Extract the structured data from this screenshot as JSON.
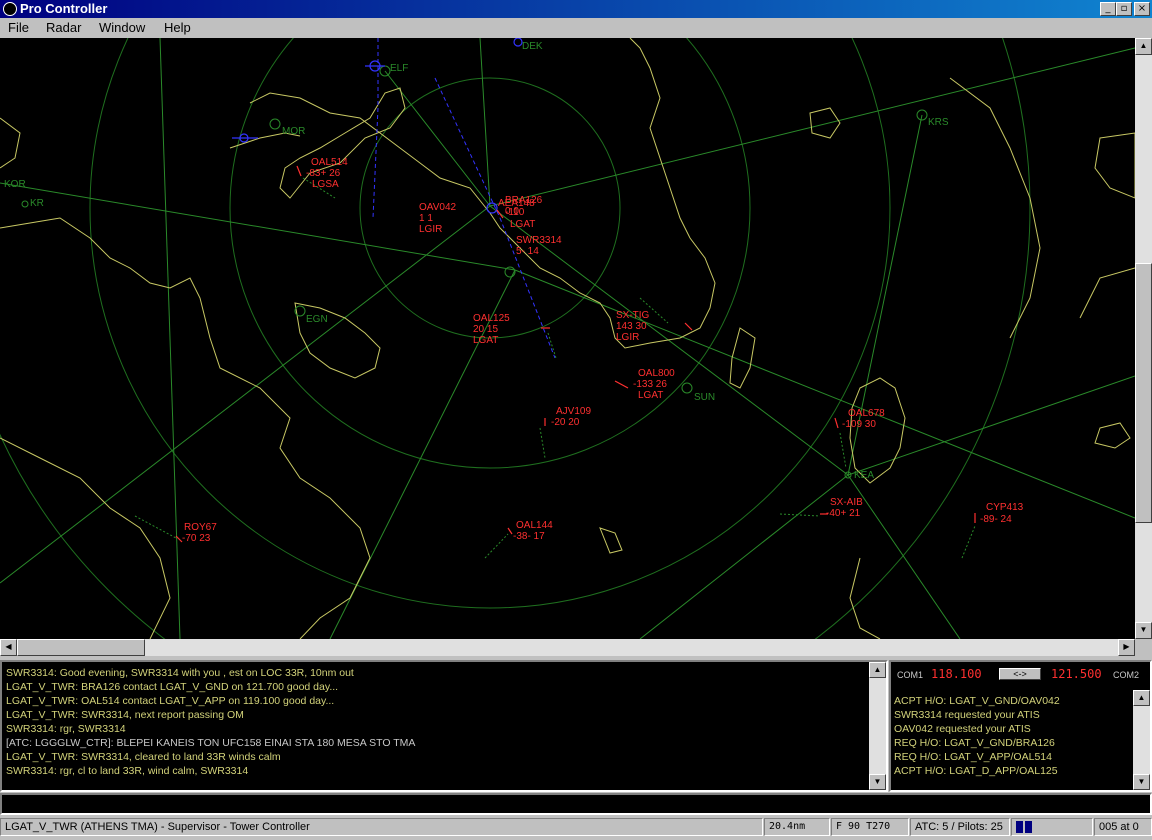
{
  "window": {
    "title": "Pro Controller",
    "minimize": "_",
    "restore": "▫",
    "close": "×"
  },
  "menu": [
    "File",
    "Radar",
    "Window",
    "Help"
  ],
  "fixes": [
    {
      "name": "ELF"
    },
    {
      "name": "DEK"
    },
    {
      "name": "MOR"
    },
    {
      "name": "KRS"
    },
    {
      "name": "KR"
    },
    {
      "name": "KOR"
    },
    {
      "name": "EGN"
    },
    {
      "name": "SUN"
    },
    {
      "name": "KEA"
    }
  ],
  "aircraft": [
    {
      "callsign": "OAL514",
      "line2": "-83+ 26",
      "dest": "LGSA"
    },
    {
      "callsign": "OAV042",
      "line2": "1  1",
      "dest": "LGIR"
    },
    {
      "callsign": "BRA126",
      "line2": "0   0",
      "dest": ""
    },
    {
      "callsign": "AEA148",
      "line2": "-110",
      "dest": "LGAT"
    },
    {
      "callsign": "SWR3314",
      "line2": "5- 14",
      "dest": ""
    },
    {
      "callsign": "OAL125",
      "line2": "20  15",
      "dest": "LGAT"
    },
    {
      "callsign": "SX-TIG",
      "line2": "143  30",
      "dest": "LGIR"
    },
    {
      "callsign": "OAL800",
      "line2": "-133  26",
      "dest": "LGAT"
    },
    {
      "callsign": "AJV109",
      "line2": "-20  20",
      "dest": ""
    },
    {
      "callsign": "OAL678",
      "line2": "-109  30",
      "dest": ""
    },
    {
      "callsign": "SX-AIB",
      "line2": "-40+ 21",
      "dest": ""
    },
    {
      "callsign": "CYP413",
      "line2": "-89- 24",
      "dest": ""
    },
    {
      "callsign": "ROY67",
      "line2": "-70  23",
      "dest": ""
    },
    {
      "callsign": "OAL144",
      "line2": "-38- 17",
      "dest": ""
    }
  ],
  "messages": [
    "SWR3314: Good evening, SWR3314 with you , est on LOC 33R, 10nm out",
    "LGAT_V_TWR: BRA126 contact LGAT_V_GND on 121.700 good day...",
    "LGAT_V_TWR: OAL514 contact LGAT_V_APP on 119.100 good day...",
    "LGAT_V_TWR: SWR3314, next report passing OM",
    "SWR3314: rgr, SWR3314",
    "[ATC: LGGGLW_CTR]: BLEPEI KANEIS TON UFC158 EINAI STA 180 MESA STO TMA",
    "LGAT_V_TWR: SWR3314, cleared to land 33R winds calm",
    "SWR3314: rgr, cl to land 33R, wind calm, SWR3314"
  ],
  "com": {
    "com1_label": "COM1",
    "com1_freq": "118.100",
    "swap_label": "<->",
    "com2_freq": "121.500",
    "com2_label": "COM2"
  },
  "notifications": [
    "ACPT H/O: LGAT_V_GND/OAV042",
    "SWR3314 requested your ATIS",
    "OAV042 requested your ATIS",
    "REQ H/O: LGAT_V_GND/BRA126",
    "REQ H/O: LGAT_V_APP/OAL514",
    "ACPT H/O: LGAT_D_APP/OAL125"
  ],
  "command": {
    "value": ""
  },
  "status": {
    "position": "LGAT_V_TWR (ATHENS TMA) - Supervisor - Tower Controller",
    "range": "20.4nm",
    "level": "F 90  T270",
    "counts": "ATC: 5 / Pilots: 25",
    "time": "005 at 0"
  },
  "colors": {
    "coast": "#c8c864",
    "route": "#2a8a2a",
    "target": "#ff3030",
    "approach": "#3333ff"
  }
}
